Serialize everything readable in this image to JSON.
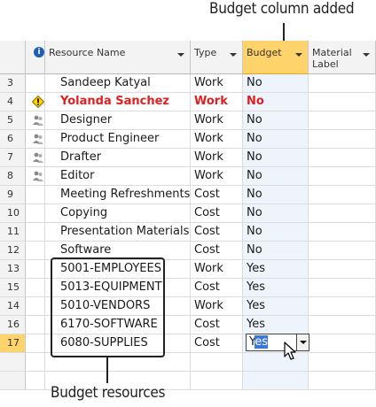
{
  "callouts": {
    "top": "Budget column added",
    "bottom": "Budget resources"
  },
  "columns": {
    "info_glyph": "i",
    "resource_name": "Resource Name",
    "type": "Type",
    "budget": "Budget",
    "material_label": "Material Label"
  },
  "rows": [
    {
      "num": "3",
      "name": "Sandeep Katyal",
      "type": "Work",
      "budget": "No",
      "icon": "",
      "highlight": false
    },
    {
      "num": "4",
      "name": "Yolanda Sanchez",
      "type": "Work",
      "budget": "No",
      "icon": "warning-icon",
      "highlight": true
    },
    {
      "num": "5",
      "name": "Designer",
      "type": "Work",
      "budget": "No",
      "icon": "generic-resource-icon",
      "highlight": false
    },
    {
      "num": "6",
      "name": "Product Engineer",
      "type": "Work",
      "budget": "No",
      "icon": "generic-resource-icon",
      "highlight": false
    },
    {
      "num": "7",
      "name": "Drafter",
      "type": "Work",
      "budget": "No",
      "icon": "generic-resource-icon",
      "highlight": false
    },
    {
      "num": "8",
      "name": "Editor",
      "type": "Work",
      "budget": "No",
      "icon": "generic-resource-icon",
      "highlight": false
    },
    {
      "num": "9",
      "name": "Meeting Refreshments",
      "type": "Cost",
      "budget": "No",
      "icon": "",
      "highlight": false
    },
    {
      "num": "10",
      "name": "Copying",
      "type": "Cost",
      "budget": "No",
      "icon": "",
      "highlight": false
    },
    {
      "num": "11",
      "name": "Presentation Materials",
      "type": "Cost",
      "budget": "No",
      "icon": "",
      "highlight": false
    },
    {
      "num": "12",
      "name": "Software",
      "type": "Cost",
      "budget": "No",
      "icon": "",
      "highlight": false
    },
    {
      "num": "13",
      "name": "5001-EMPLOYEES",
      "type": "Work",
      "budget": "Yes",
      "icon": "",
      "highlight": false
    },
    {
      "num": "15",
      "name": "5013-EQUIPMENT",
      "type": "Cost",
      "budget": "Yes",
      "icon": "",
      "highlight": false
    },
    {
      "num": "14",
      "name": "5010-VENDORS",
      "type": "Work",
      "budget": "Yes",
      "icon": "",
      "highlight": false
    },
    {
      "num": "16",
      "name": "6170-SOFTWARE",
      "type": "Cost",
      "budget": "Yes",
      "icon": "",
      "highlight": false
    },
    {
      "num": "17",
      "name": "6080-SUPPLIES",
      "type": "Cost",
      "budget": "",
      "icon": "",
      "highlight": false
    }
  ],
  "editor": {
    "value_prefix": "Y",
    "value_selected": "es"
  },
  "colors": {
    "accent_header": "#ffd36b",
    "warning_red": "#e02020",
    "selection_blue": "#3b78d8"
  }
}
